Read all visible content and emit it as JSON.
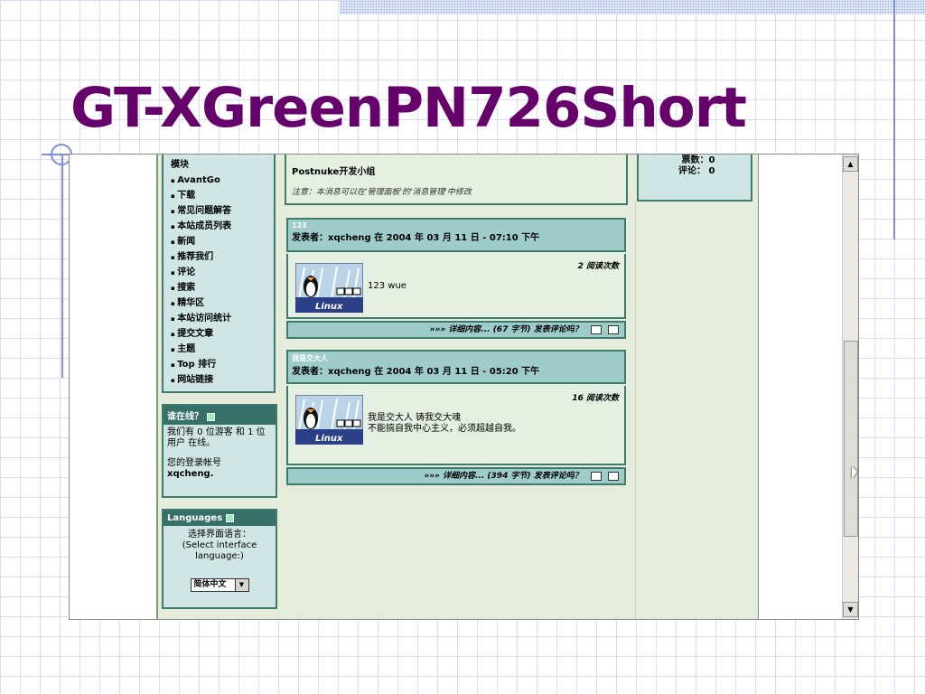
{
  "slide": {
    "title": "GT-XGreenPN726Short"
  },
  "modules": {
    "title": "模块",
    "items": [
      "AvantGo",
      "下载",
      "常见问题解答",
      "本站成员列表",
      "新闻",
      "推荐我们",
      "评论",
      "搜索",
      "精华区",
      "本站访问统计",
      "提交文章",
      "主题",
      "Top 排行",
      "网站链接"
    ]
  },
  "online": {
    "header": "谁在线？",
    "line1": "我们有 0 位游客 和 1 位用户 在线。",
    "line2": "您的登录帐号",
    "user": "xqcheng."
  },
  "languages": {
    "header": "Languages",
    "prompt": "选择界面语言：(Select interface language:)",
    "selected": "简体中文"
  },
  "top_box": {
    "title": "Postnuke开发小组",
    "note": "注意：本消息可以在'管理面板'的'消息管理'中修改"
  },
  "poll": {
    "votes": "票数：0",
    "comments": "评论： 0"
  },
  "stories": [
    {
      "subtitle": "123",
      "byline": "发表者：xqcheng 在  2004 年  03 月  11 日  - 07:10 下午",
      "reads": "2 阅读次数",
      "text1": "123 wue",
      "text2": "",
      "footer": "»»» 详细内容... (67 字节) 发表评论吗？"
    },
    {
      "subtitle": "我是交大人",
      "byline": "发表者：xqcheng 在  2004 年  03 月  11 日  - 05:20 下午",
      "reads": "16 阅读次数",
      "text1": "我是交大人  铸我交大魂",
      "text2": "不能搞自我中心主义，必须超越自我。",
      "footer": "»»» 详细内容... (394 字节) 发表评论吗？"
    }
  ],
  "logo": {
    "label": "Linux"
  },
  "colors": {
    "title": "#66006a",
    "box_border": "#3e7b6a",
    "box_header": "#367069"
  }
}
